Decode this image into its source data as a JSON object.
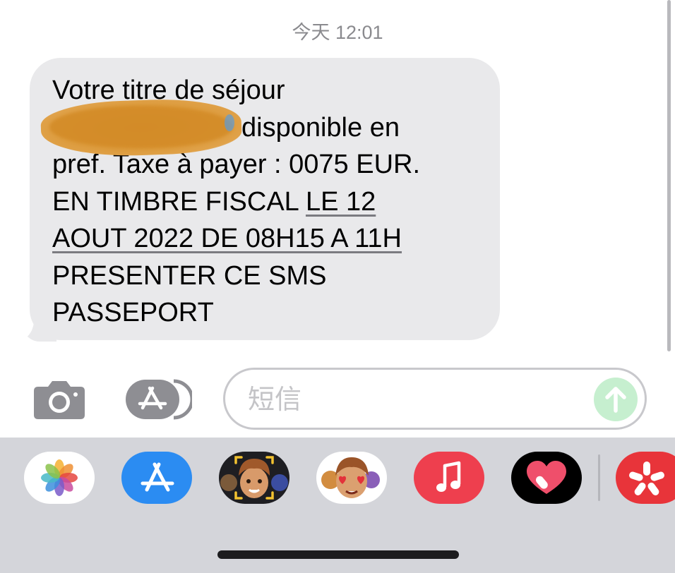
{
  "header": {
    "timestamp": "今天 12:01"
  },
  "message": {
    "lines": [
      "Votre titre de séjour",
      "disponible en",
      "pref. Taxe à payer : 0075 EUR.",
      "EN TIMBRE FISCAL",
      "LE 12",
      "AOUT 2022 DE 08H15 A 11H",
      "PRESENTER CE SMS",
      "PASSEPORT"
    ]
  },
  "input_bar": {
    "camera_icon": "camera-icon",
    "apps_icon": "app-store-icon",
    "placeholder": "短信",
    "value": "",
    "send_icon": "arrow-up-icon"
  },
  "app_drawer": {
    "apps": [
      {
        "icon": "photos-icon"
      },
      {
        "icon": "app-store-icon"
      },
      {
        "icon": "memoji-camera-icon"
      },
      {
        "icon": "memoji-stickers-icon"
      },
      {
        "icon": "music-icon"
      },
      {
        "icon": "digital-touch-icon"
      },
      {
        "icon": "yelp-icon"
      }
    ]
  },
  "colors": {
    "bubble_bg": "#e9e9eb",
    "drawer_bg": "#d4d5da",
    "send_disabled": "#c6efcf",
    "app_store_blue": "#2b8cf2",
    "music_red": "#ee3f4e",
    "yelp_red": "#e8343a"
  }
}
